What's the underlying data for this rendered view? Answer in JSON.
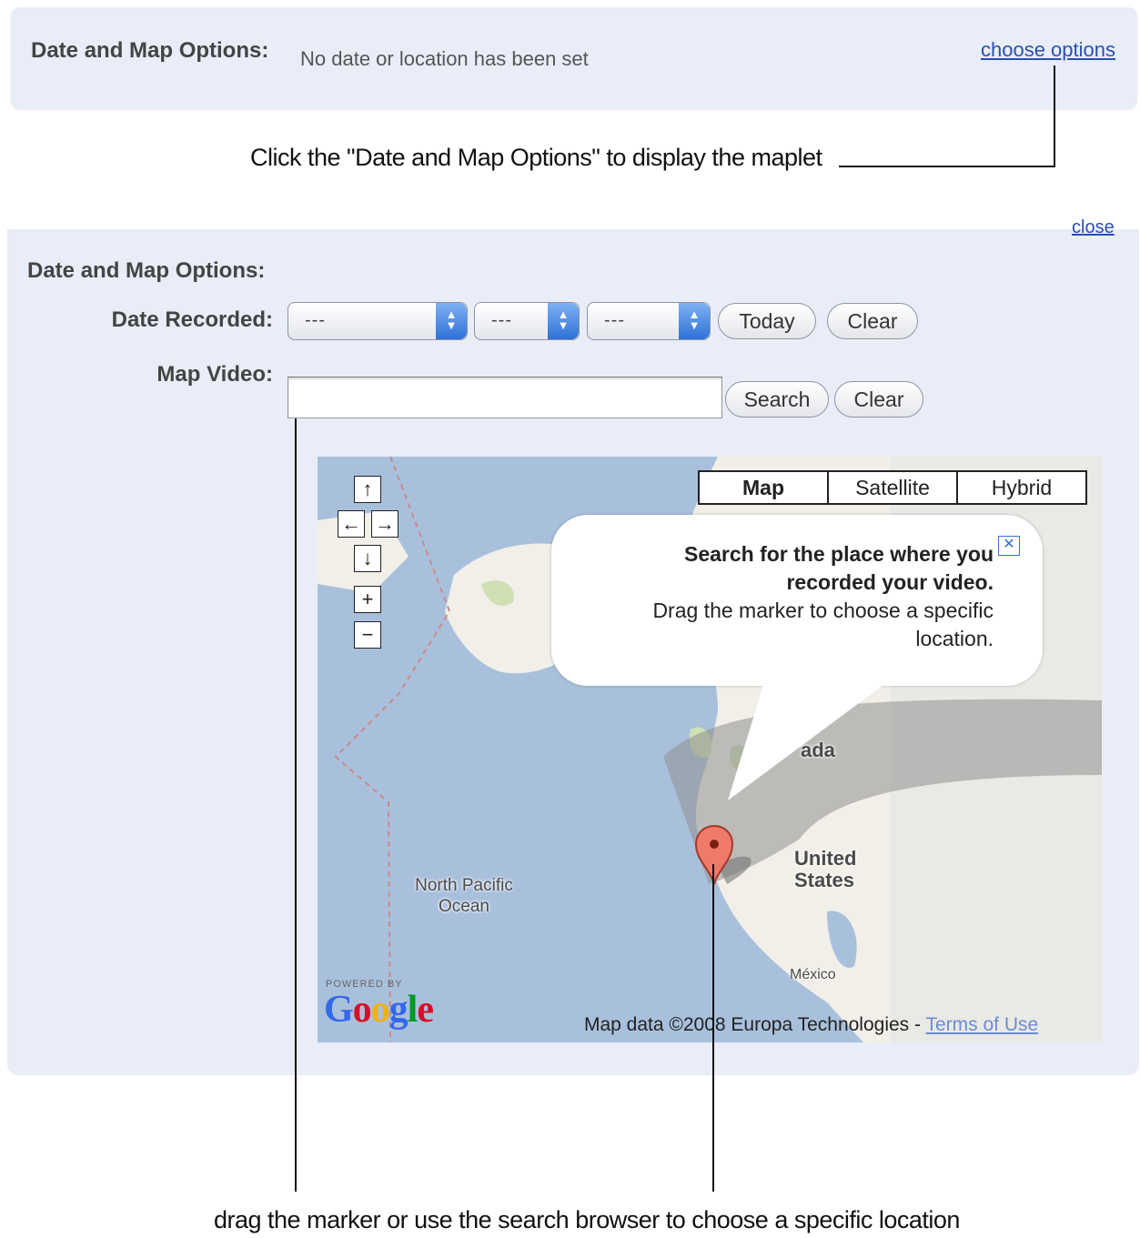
{
  "top_bar": {
    "title": "Date and Map Options:",
    "status": "No date or location has been set",
    "link": "choose options"
  },
  "annotations": {
    "top": "Click the \"Date and Map Options\" to display the maplet",
    "bottom": "drag the marker or use the search browser to choose a specific location"
  },
  "panel": {
    "close_link": "close",
    "title": "Date and Map Options:",
    "date_label": "Date Recorded:",
    "date_selects": [
      "---",
      "---",
      "---"
    ],
    "today_button": "Today",
    "clear_date_button": "Clear",
    "map_label": "Map Video:",
    "search_value": "",
    "search_button": "Search",
    "clear_search_button": "Clear"
  },
  "map": {
    "nav": {
      "up": "↑",
      "left": "←",
      "right": "→",
      "down": "↓",
      "zoom_in": "+",
      "zoom_out": "−"
    },
    "types": [
      "Map",
      "Satellite",
      "Hybrid"
    ],
    "active_type": "Map",
    "bubble": {
      "line1": "Search for the place where you",
      "line2": "recorded your video.",
      "line3": "Drag the marker to choose a specific",
      "line4": "location.",
      "close": "✕"
    },
    "labels": {
      "canada": "ada",
      "us_1": "United",
      "us_2": "States",
      "ocean_1": "North Pacific",
      "ocean_2": "Ocean",
      "mexico": "México"
    },
    "powered_by": "POWERED BY",
    "logo_letters": [
      "G",
      "o",
      "o",
      "g",
      "l",
      "e"
    ],
    "attribution": "Map data ©2008 Europa Technologies - ",
    "terms_link": "Terms of Use"
  },
  "colors": {
    "panel_bg": "#e8edf7",
    "link": "#2a4fb0",
    "water": "#a9c0dc",
    "land": "#f1efe8",
    "marker": "#f07a6a",
    "logo": [
      "#3369e8",
      "#d50f25",
      "#eeb211",
      "#3369e8",
      "#009925",
      "#d50f25"
    ]
  }
}
